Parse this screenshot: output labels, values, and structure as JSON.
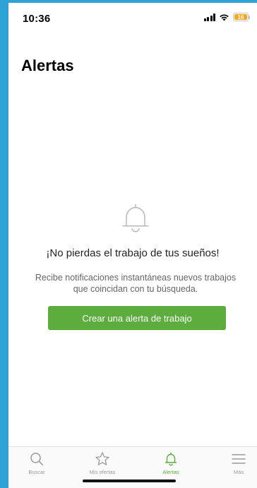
{
  "status_bar": {
    "time": "10:36",
    "battery": "16",
    "icons": [
      "signal-icon",
      "wifi-icon",
      "battery-icon"
    ]
  },
  "page": {
    "title": "Alertas"
  },
  "empty_state": {
    "icon": "bell-icon",
    "headline": "¡No pierdas el trabajo de tus sueños!",
    "description": "Recibe notificaciones instantáneas nuevos trabajos que coincidan con tu búsqueda.",
    "button_label": "Crear una alerta de trabajo"
  },
  "tab_bar": {
    "tabs": [
      {
        "label": "Buscar",
        "icon": "search-icon",
        "active": false
      },
      {
        "label": "Mis ofertas",
        "icon": "star-icon",
        "active": false
      },
      {
        "label": "Alertas",
        "icon": "bell-icon",
        "active": true
      },
      {
        "label": "Más",
        "icon": "menu-icon",
        "active": false
      }
    ]
  },
  "colors": {
    "accent": "#5cad3d",
    "frame": "#2fa3d6",
    "inactive": "#9a9a9a",
    "battery": "#f5a623"
  }
}
